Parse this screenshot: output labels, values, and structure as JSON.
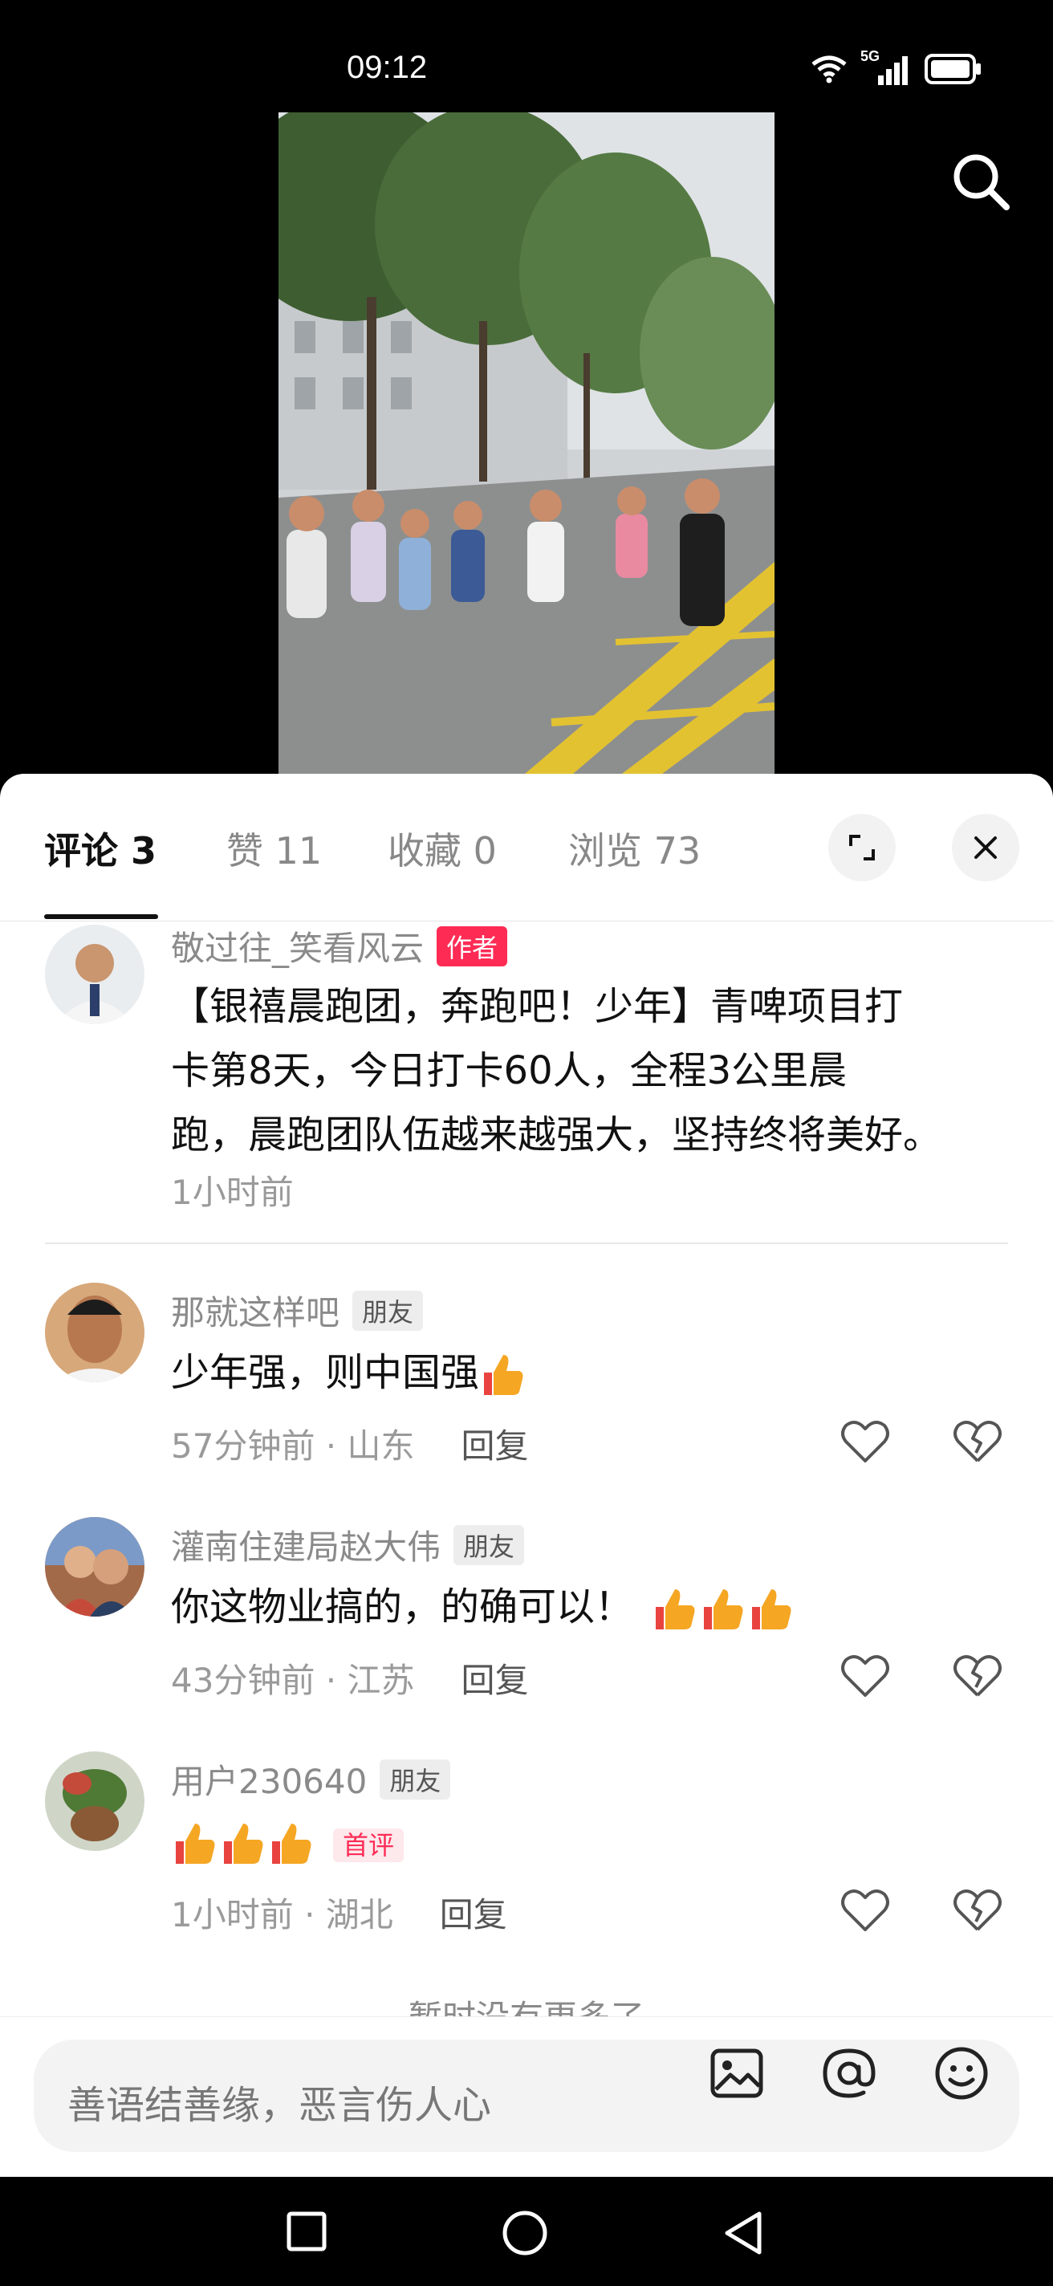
{
  "status_bar": {
    "time": "09:12",
    "network": "5G"
  },
  "video": {
    "search_label": "search"
  },
  "tabs": [
    {
      "label": "评论 3",
      "active": true
    },
    {
      "label": "赞 11",
      "active": false
    },
    {
      "label": "收藏 0",
      "active": false
    },
    {
      "label": "浏览 73",
      "active": false
    }
  ],
  "author_post": {
    "username": "敬过往_笑看风云",
    "tag": "作者",
    "text_lines": [
      "【银禧晨跑团，奔跑吧！少年】青啤项目打",
      "卡第8天，今日打卡60人，全程3公里晨",
      "跑，晨跑团队伍越来越强大，坚持终将美好。"
    ],
    "time": "1小时前"
  },
  "comments": [
    {
      "username": "那就这样吧",
      "tag": "朋友",
      "text": "少年强，则中国强",
      "thumbs": 1,
      "time": "57分钟前 · 山东",
      "reply": "回复"
    },
    {
      "username": "灌南住建局赵大伟",
      "tag": "朋友",
      "text": "你这物业搞的，的确可以！",
      "thumbs": 3,
      "time": "43分钟前 · 江苏",
      "reply": "回复"
    },
    {
      "username": "用户230640",
      "tag": "朋友",
      "text": "",
      "thumbs": 3,
      "badge": "首评",
      "time": "1小时前 · 湖北",
      "reply": "回复"
    }
  ],
  "end_text": "暂时没有更多了",
  "input": {
    "placeholder": "善语结善缘，恶言伤人心"
  },
  "colors": {
    "accent": "#fe2c55",
    "thumb": "#f5a623"
  }
}
